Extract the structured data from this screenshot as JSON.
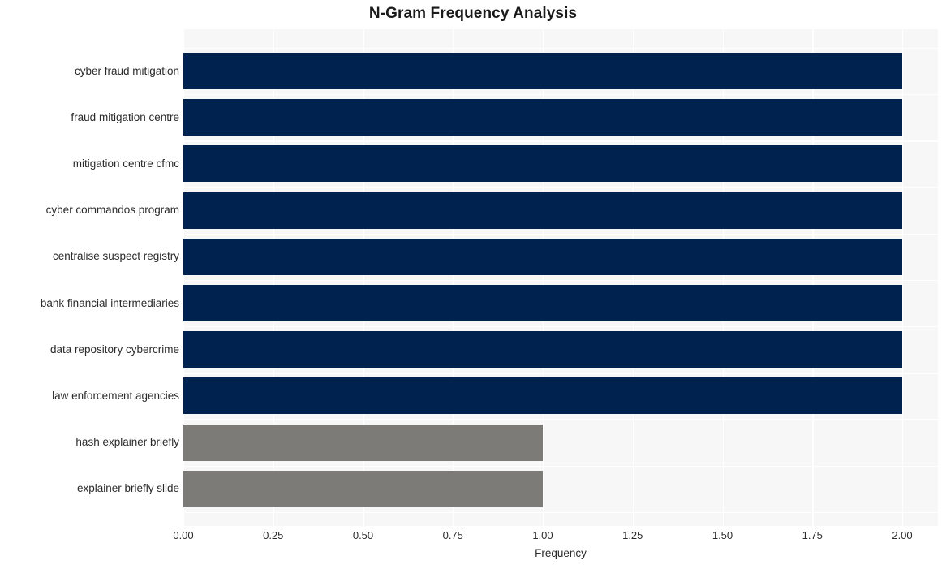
{
  "chart_data": {
    "type": "bar",
    "orientation": "horizontal",
    "title": "N-Gram Frequency Analysis",
    "xlabel": "Frequency",
    "ylabel": "",
    "xlim": [
      0,
      2.0
    ],
    "xticks": [
      "0.00",
      "0.25",
      "0.50",
      "0.75",
      "1.00",
      "1.25",
      "1.50",
      "1.75",
      "2.00"
    ],
    "xtick_values": [
      0,
      0.25,
      0.5,
      0.75,
      1.0,
      1.25,
      1.5,
      1.75,
      2.0
    ],
    "grid": true,
    "legend": "none",
    "categories": [
      "cyber fraud mitigation",
      "fraud mitigation centre",
      "mitigation centre cfmc",
      "cyber commandos program",
      "centralise suspect registry",
      "bank financial intermediaries",
      "data repository cybercrime",
      "law enforcement agencies",
      "hash explainer briefly",
      "explainer briefly slide"
    ],
    "values": [
      2,
      2,
      2,
      2,
      2,
      2,
      2,
      2,
      1,
      1
    ],
    "bar_colors": [
      "#00224e",
      "#00224e",
      "#00224e",
      "#00224e",
      "#00224e",
      "#00224e",
      "#00224e",
      "#00224e",
      "#7d7b78",
      "#7d7b78"
    ]
  },
  "style": {
    "plot_background": "#f7f7f7",
    "grid_color": "#ffffff",
    "figure_background": "#ffffff",
    "primary_color": "#00224e",
    "secondary_color": "#7d7b78",
    "text_color": "#2b2b2b"
  }
}
